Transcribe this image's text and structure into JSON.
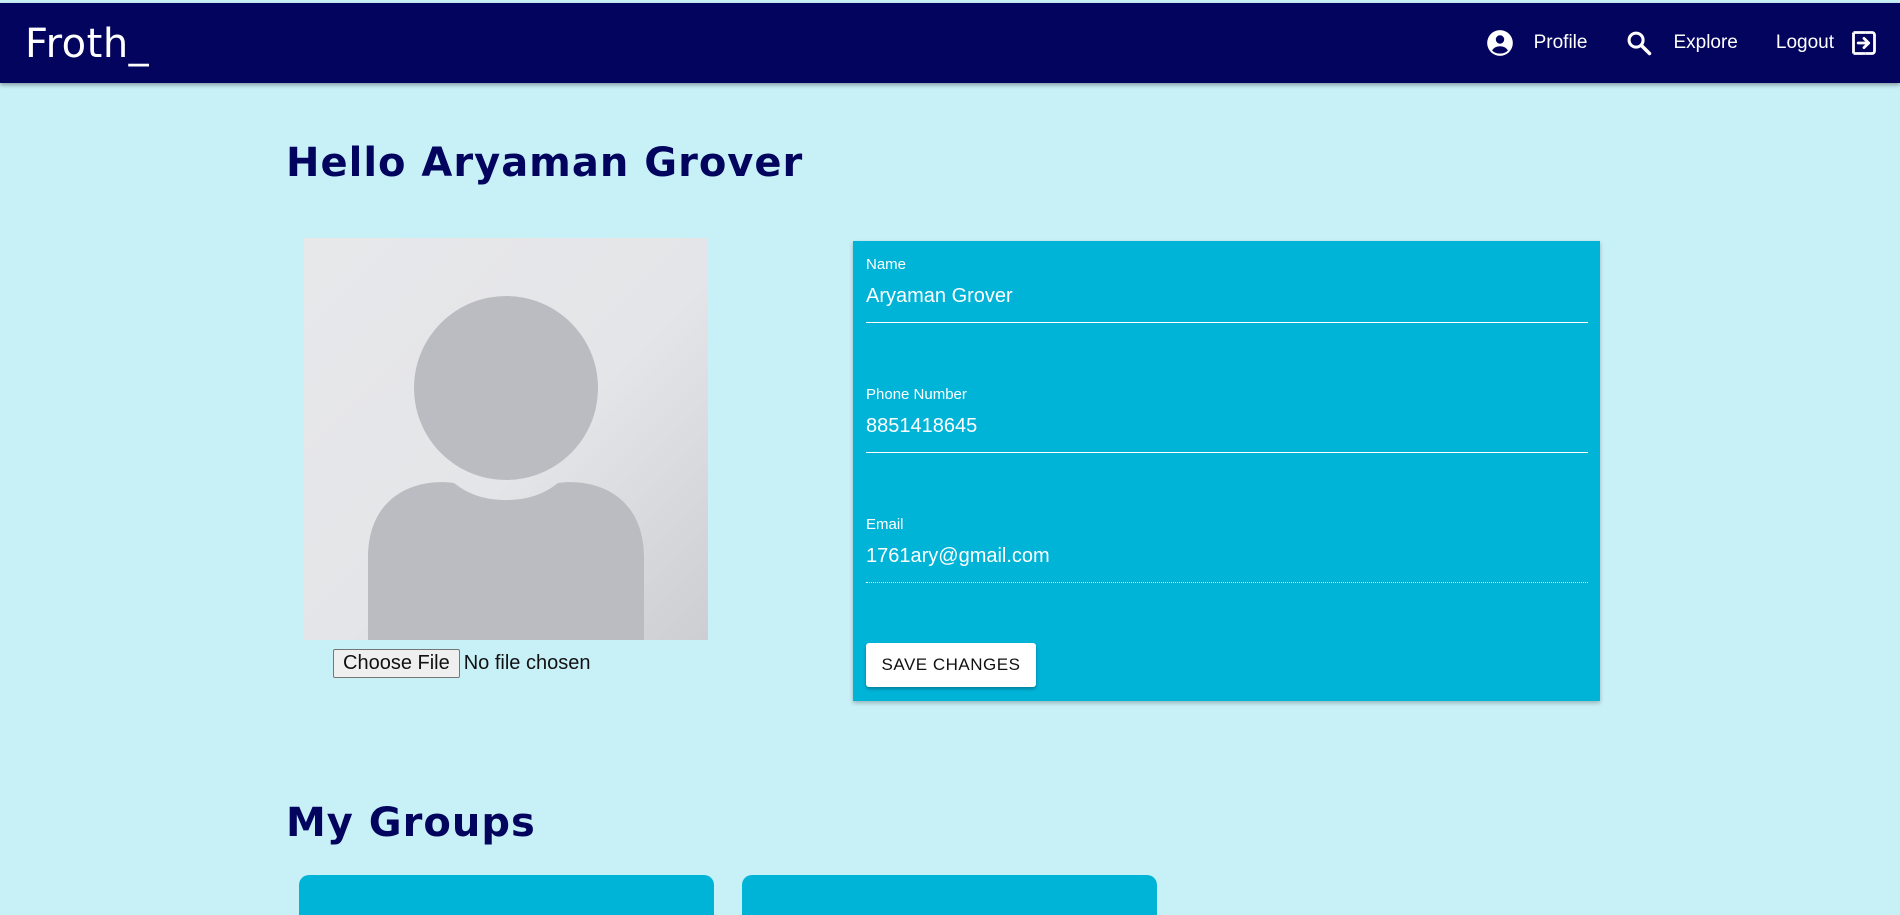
{
  "header": {
    "brand": "Froth_",
    "nav": [
      {
        "label": "Profile",
        "icon": "account-circle-icon"
      },
      {
        "label": "Explore",
        "icon": "search-icon"
      },
      {
        "label": "Logout",
        "icon": "logout-icon"
      }
    ]
  },
  "profile": {
    "greeting": "Hello Aryaman Grover",
    "avatar_icon": "default-avatar-icon",
    "file_input": {
      "button_label": "Choose File",
      "status": "No file chosen"
    }
  },
  "form": {
    "name": {
      "label": "Name",
      "value": "Aryaman Grover"
    },
    "phone": {
      "label": "Phone Number",
      "value": "8851418645"
    },
    "email": {
      "label": "Email",
      "value": "1761ary@gmail.com"
    },
    "save_label": "SAVE CHANGES"
  },
  "groups": {
    "heading": "My Groups"
  },
  "colors": {
    "navbar": "#02045e",
    "background": "#c8f0f7",
    "card": "#00b4d8",
    "heading": "#02045e"
  }
}
